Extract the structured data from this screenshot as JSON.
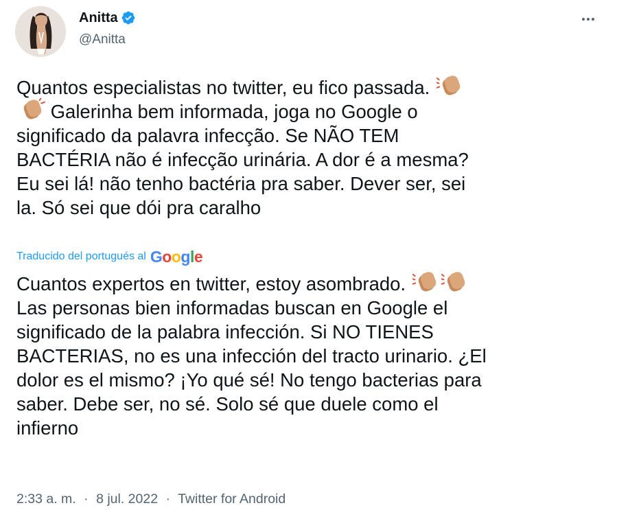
{
  "author": {
    "name": "Anitta",
    "handle": "@Anitta",
    "verified_color": "#1d9bf0"
  },
  "menu": {
    "icon": "more-horizontal-icon"
  },
  "tweet": {
    "original_lines": [
      {
        "text": "Quantos especialistas no twitter, eu fico passada. ",
        "trailing_emoji": "clapping-hands-icon"
      },
      {
        "leading_emoji": "clapping-hands-icon",
        "text": " Galerinha bem informada, joga no Google o"
      },
      {
        "text": "significado da palavra infecção. Se NÃO TEM"
      },
      {
        "text": "BACTÉRIA não é infecção urinária. A dor é a mesma?"
      },
      {
        "text": "Eu sei lá! não tenho bactéria pra saber. Dever ser, sei"
      },
      {
        "text": "la. Só sei que dói pra caralho"
      }
    ],
    "translation_label": "Traducido del portugués al",
    "translation_provider": "Google",
    "translated_lines": [
      {
        "text": "Cuantos expertos en twitter, estoy asombrado. ",
        "trailing_emojis": [
          "clapping-hands-icon",
          "clapping-hands-icon"
        ]
      },
      {
        "text": "Las personas bien informadas buscan en Google el"
      },
      {
        "text": "significado de la palabra infección. Si NO TIENES"
      },
      {
        "text": "BACTERIAS, no es una infección del tracto urinario. ¿El"
      },
      {
        "text": "dolor es el mismo? ¡Yo qué sé! No tengo bacterias para"
      },
      {
        "text": "saber. Debe ser, no sé. Solo sé que duele como el"
      },
      {
        "text": "infierno"
      }
    ],
    "time": "2:33 a. m.",
    "separator": "·",
    "date": "8 jul. 2022",
    "source": "Twitter for Android"
  },
  "colors": {
    "text": "#0f1419",
    "secondary": "#536471",
    "link": "#1d9bf0",
    "google_blue": "#4285f4",
    "google_red": "#ea4335",
    "google_yellow": "#fbbc05",
    "google_green": "#34a853"
  }
}
